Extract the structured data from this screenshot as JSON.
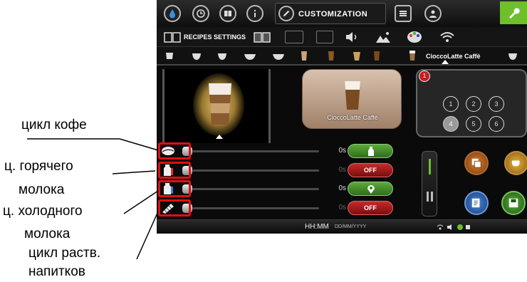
{
  "screen": {
    "nav": {
      "customization_label": "CUSTOMIZATION",
      "icons": [
        "drop-icon",
        "clock-icon",
        "book-icon",
        "info-icon",
        "pencil-icon",
        "list-icon",
        "user-icon",
        "wrench-icon"
      ]
    },
    "recipes_row": {
      "label": "RECIPES SETTINGS",
      "icons": [
        "book-icon",
        "picture-icon",
        "screen-icon",
        "speaker-icon",
        "landscape-icon",
        "palette-icon",
        "wifi-icon"
      ]
    },
    "drinks_row": {
      "selected_label": "CioccoLatte Caffè"
    },
    "card": {
      "label": "CioccoLatte Caffè"
    },
    "panel": {
      "badge": "1",
      "numbers": [
        "1",
        "2",
        "3",
        "4",
        "5",
        "6"
      ],
      "selected": "4"
    },
    "sliders": [
      {
        "name": "coffee-cycle",
        "value": "0s",
        "button": "milk-bottle",
        "button_color": "green"
      },
      {
        "name": "hot-milk-cycle",
        "value": "0s",
        "button": "OFF",
        "button_color": "red"
      },
      {
        "name": "cold-milk-cycle",
        "value": "0s",
        "button": "location",
        "button_color": "green"
      },
      {
        "name": "soluble-cycle",
        "value": "0s",
        "button": "OFF",
        "button_color": "red"
      }
    ],
    "footer": {
      "time": "HH:MM",
      "date": "DD/MM/YYYY"
    }
  },
  "annotations": {
    "coffee": "цикл кофе",
    "hot_milk_1": "ц. горячего",
    "hot_milk_2": "молока",
    "cold_milk_1": "ц. холодного",
    "cold_milk_2": "молока",
    "soluble_1": "цикл раств.",
    "soluble_2": "напитков"
  },
  "colors": {
    "accent_green": "#6fbf2a",
    "off_red": "#c62a2a",
    "highlight_red": "#e01010"
  }
}
